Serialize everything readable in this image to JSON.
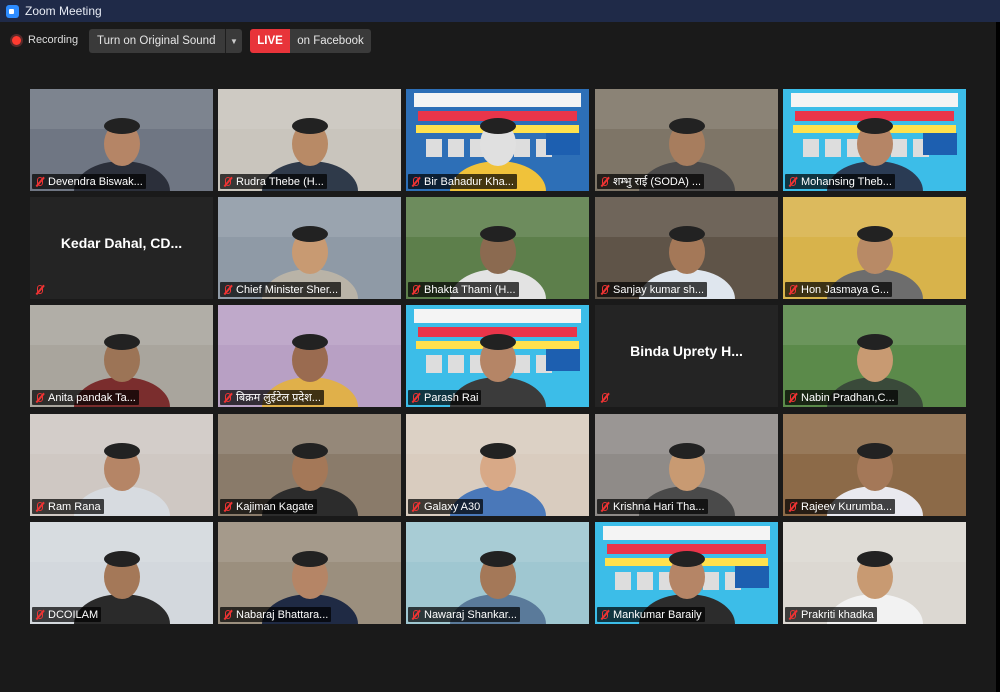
{
  "window": {
    "title": "Zoom Meeting"
  },
  "toolbar": {
    "recording_label": "Recording",
    "sound_label": "Turn on Original Sound",
    "live_label": "LIVE",
    "live_destination": "on Facebook"
  },
  "participants": [
    {
      "name": "Devendra Biswak...",
      "bg": "#6f7683",
      "fg": "#2b2f3a",
      "face": "#b58566"
    },
    {
      "name": "Rudra Thebe (H...",
      "bg": "#c9c5bd",
      "fg": "#2f3a4a",
      "face": "#b88a66"
    },
    {
      "name": "Bir Bahadur Kha...",
      "bg": "#2d6fb7",
      "fg": "#f0c23a",
      "face": "#e0e0e0",
      "poster": true
    },
    {
      "name": "शम्भु राई (SODA) ...",
      "bg": "#7e7567",
      "fg": "#4b4a4a",
      "face": "#a77d5e"
    },
    {
      "name": "Mohansing Theb...",
      "bg": "#3cbde8",
      "fg": "#2a3b54",
      "face": "#b58566",
      "poster": true
    },
    {
      "name": "",
      "label": "Kedar Dahal, CD...",
      "bg": "#242424"
    },
    {
      "name": "Chief Minister Sher...",
      "bg": "#8f9aa6",
      "fg": "#b9b3a7",
      "face": "#c89a72",
      "active": true
    },
    {
      "name": "Bhakta Thami (H...",
      "bg": "#5d7f4b",
      "fg": "#e3e3e3",
      "face": "#8b6a50"
    },
    {
      "name": "Sanjay kumar sh...",
      "bg": "#5f5448",
      "fg": "#dfe6ee",
      "face": "#a47858"
    },
    {
      "name": "Hon Jasmaya G...",
      "bg": "#d8b34b",
      "fg": "#6d6d6d",
      "face": "#b88a66"
    },
    {
      "name": "Anita pandak Ta...",
      "bg": "#a9a59d",
      "fg": "#7a2d2d",
      "face": "#9c7456"
    },
    {
      "name": "बिक्रम लुईटेल प्रदेश...",
      "bg": "#b8a0c4",
      "fg": "#e0b04a",
      "face": "#9a6b50"
    },
    {
      "name": "Parash Rai",
      "bg": "#3cbde8",
      "fg": "#3b3b3b",
      "face": "#b58566",
      "poster": true
    },
    {
      "name": "",
      "label": "Binda Uprety H...",
      "bg": "#242424"
    },
    {
      "name": "Nabin Pradhan,C...",
      "bg": "#5b8a4a",
      "fg": "#3a4a3a",
      "face": "#c89a72"
    },
    {
      "name": "Ram Rana",
      "bg": "#cfc8c3",
      "fg": "#d7dbe0",
      "face": "#b58566"
    },
    {
      "name": "Kajiman Kagate",
      "bg": "#8a7b6a",
      "fg": "#2c2c2c",
      "face": "#a47858"
    },
    {
      "name": "Galaxy A30",
      "bg": "#d9ccbf",
      "fg": "#4a78b9",
      "face": "#d8a987"
    },
    {
      "name": "Krishna Hari Tha...",
      "bg": "#8f8b88",
      "fg": "#4a4a4a",
      "face": "#c89a72"
    },
    {
      "name": "Rajeev Kurumba...",
      "bg": "#8c6a48",
      "fg": "#e9e9ef",
      "face": "#a47858"
    },
    {
      "name": "DCOILAM",
      "bg": "#d3d8dd",
      "fg": "#2a2a2a",
      "face": "#a47858"
    },
    {
      "name": "Nabaraj Bhattara...",
      "bg": "#9b8f7e",
      "fg": "#1f2a44",
      "face": "#b58566"
    },
    {
      "name": "Nawaraj Shankar...",
      "bg": "#9fc7d1",
      "fg": "#5a7a9a",
      "face": "#a47858"
    },
    {
      "name": "Mankumar Baraily",
      "bg": "#3cbde8",
      "fg": "#2c2c2c",
      "face": "#b58566",
      "poster": true
    },
    {
      "name": "Prakriti khadka",
      "bg": "#dcd8d2",
      "fg": "#f2f2f2",
      "face": "#c89a72"
    }
  ]
}
